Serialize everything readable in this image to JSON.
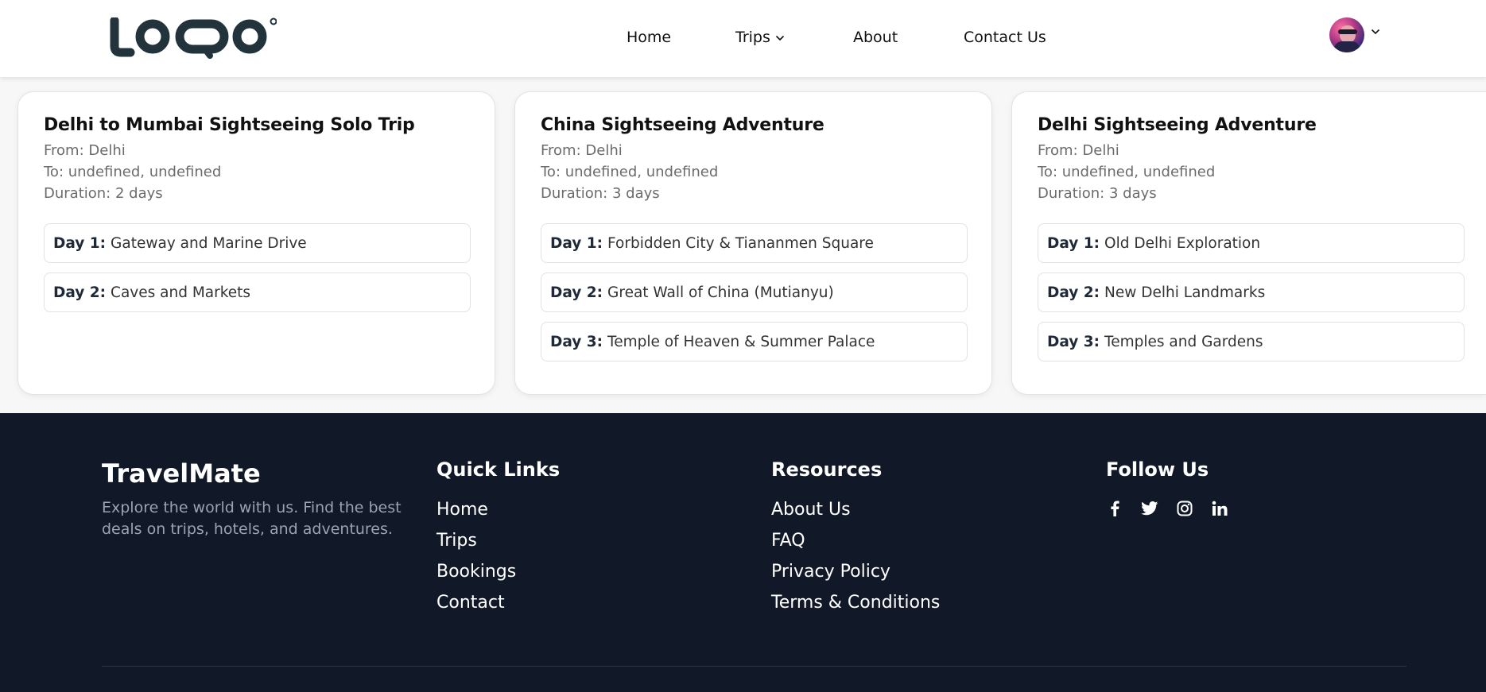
{
  "header": {
    "nav": [
      {
        "id": "home",
        "label": "Home"
      },
      {
        "id": "trips",
        "label": "Trips"
      },
      {
        "id": "about",
        "label": "About"
      },
      {
        "id": "contact",
        "label": "Contact Us"
      }
    ]
  },
  "trips": [
    {
      "title": "Delhi to Mumbai Sightseeing Solo Trip",
      "from": "From: Delhi",
      "to": "To: undefined, undefined",
      "duration": "Duration: 2 days",
      "days": [
        {
          "num": "Day 1:",
          "text": "Gateway and Marine Drive"
        },
        {
          "num": "Day 2:",
          "text": "Caves and Markets"
        }
      ]
    },
    {
      "title": "China Sightseeing Adventure",
      "from": "From: Delhi",
      "to": "To: undefined, undefined",
      "duration": "Duration: 3 days",
      "days": [
        {
          "num": "Day 1:",
          "text": "Forbidden City & Tiananmen Square"
        },
        {
          "num": "Day 2:",
          "text": "Great Wall of China (Mutianyu)"
        },
        {
          "num": "Day 3:",
          "text": "Temple of Heaven & Summer Palace"
        }
      ]
    },
    {
      "title": "Delhi Sightseeing Adventure",
      "from": "From: Delhi",
      "to": "To: undefined, undefined",
      "duration": "Duration: 3 days",
      "days": [
        {
          "num": "Day 1:",
          "text": "Old Delhi Exploration"
        },
        {
          "num": "Day 2:",
          "text": "New Delhi Landmarks"
        },
        {
          "num": "Day 3:",
          "text": "Temples and Gardens"
        }
      ]
    }
  ],
  "footer": {
    "brand": "TravelMate",
    "tagline": "Explore the world with us. Find the best deals on trips, hotels, and adventures.",
    "quick_links": {
      "title": "Quick Links",
      "items": [
        "Home",
        "Trips",
        "Bookings",
        "Contact"
      ]
    },
    "resources": {
      "title": "Resources",
      "items": [
        "About Us",
        "FAQ",
        "Privacy Policy",
        "Terms & Conditions"
      ]
    },
    "follow": {
      "title": "Follow Us",
      "icons": [
        "facebook-icon",
        "twitter-icon",
        "instagram-icon",
        "linkedin-icon"
      ]
    }
  },
  "colors": {
    "footer_bg": "#111827",
    "logo": "#22333b"
  }
}
